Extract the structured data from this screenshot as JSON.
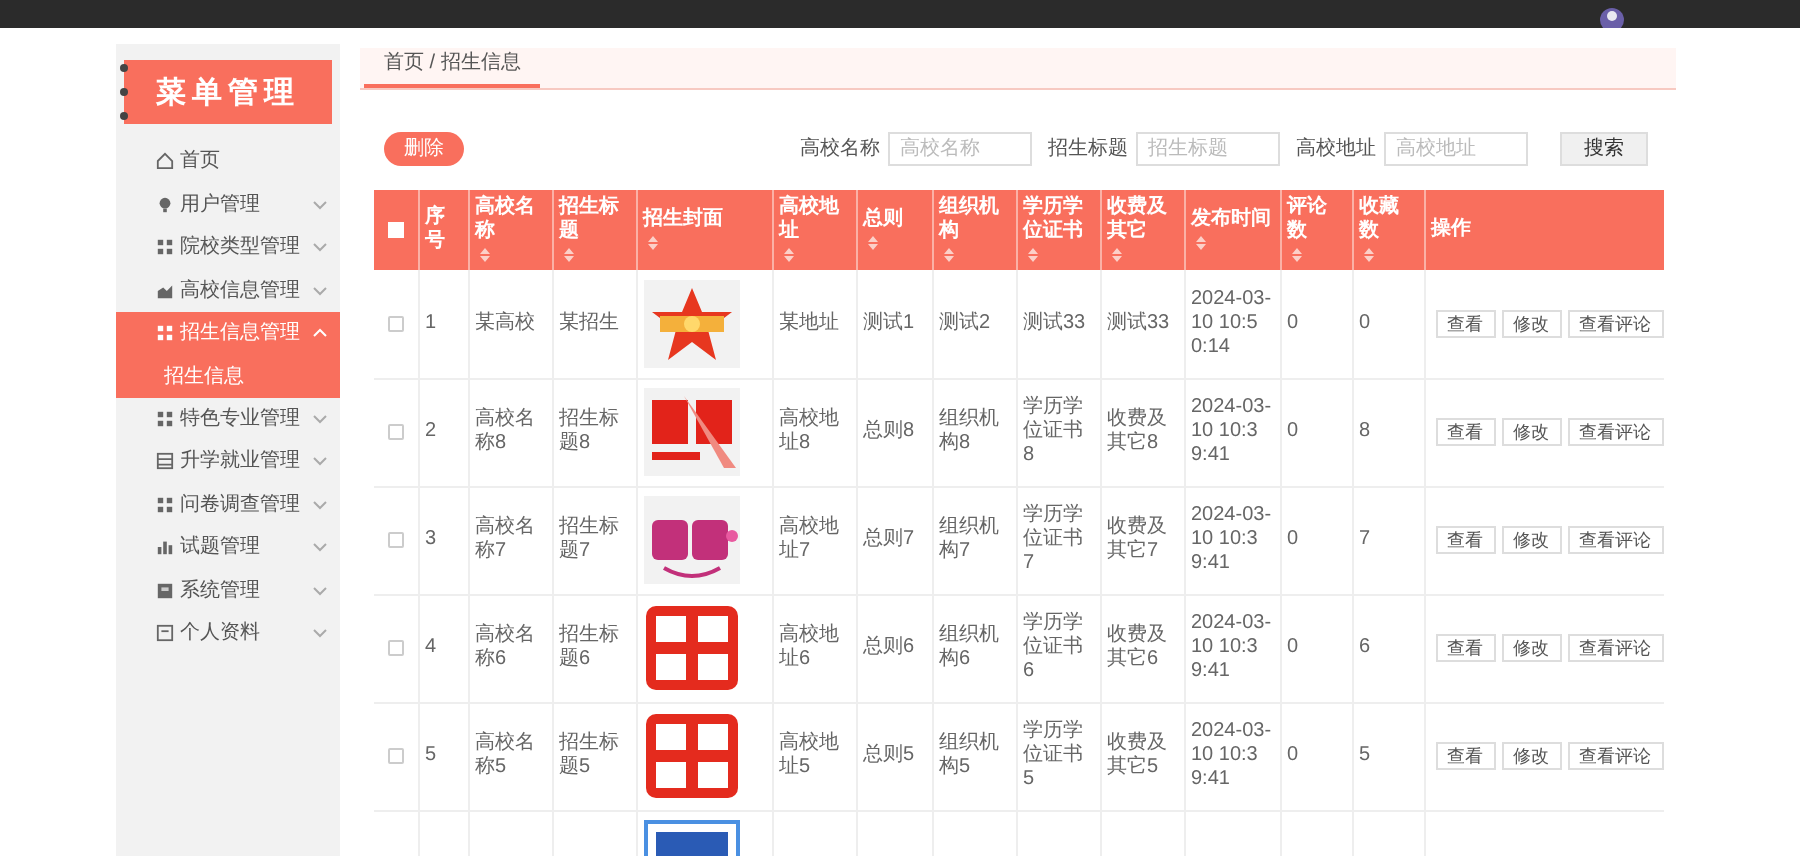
{
  "sidebar": {
    "title": "菜单管理",
    "items": [
      {
        "label": "首页"
      },
      {
        "label": "用户管理",
        "expanded": false,
        "selected": false
      },
      {
        "label": "院校类型管理",
        "expanded": false,
        "selected": false
      },
      {
        "label": "高校信息管理",
        "expanded": false,
        "selected": false
      },
      {
        "label": "招生信息管理",
        "expanded": true,
        "selected": true,
        "children": [
          {
            "label": "招生信息",
            "selected": true
          }
        ]
      },
      {
        "label": "特色专业管理",
        "expanded": false,
        "selected": false
      },
      {
        "label": "升学就业管理",
        "expanded": false,
        "selected": false
      },
      {
        "label": "问卷调查管理",
        "expanded": false,
        "selected": false
      },
      {
        "label": "试题管理",
        "expanded": false,
        "selected": false
      },
      {
        "label": "系统管理",
        "expanded": false,
        "selected": false
      },
      {
        "label": "个人资料",
        "expanded": false,
        "selected": false
      }
    ]
  },
  "breadcrumb": "首页 / 招生信息",
  "toolbar": {
    "delete_button": "删除",
    "filters": [
      {
        "label": "高校名称",
        "placeholder": "高校名称"
      },
      {
        "label": "招生标题",
        "placeholder": "招生标题"
      },
      {
        "label": "高校地址",
        "placeholder": "高校地址"
      }
    ],
    "search_button": "搜索"
  },
  "table": {
    "select_all": {
      "checked": false
    },
    "columns": [
      {
        "label": "序号",
        "sortable": false
      },
      {
        "label": "高校名称",
        "sortable": true
      },
      {
        "label": "招生标题",
        "sortable": true
      },
      {
        "label": "招生封面",
        "sortable": true
      },
      {
        "label": "高校地址",
        "sortable": true
      },
      {
        "label": "总则",
        "sortable": true
      },
      {
        "label": "组织机构",
        "sortable": true
      },
      {
        "label": "学历学位证书",
        "sortable": true
      },
      {
        "label": "收费及其它",
        "sortable": true
      },
      {
        "label": "发布时间",
        "sortable": true
      },
      {
        "label": "评论数",
        "sortable": true
      },
      {
        "label": "收藏数",
        "sortable": true
      },
      {
        "label": "操作",
        "sortable": false
      }
    ],
    "rows": [
      {
        "selected": false,
        "actions": [
          "查看",
          "修改",
          "查看评论"
        ],
        "cells": [
          "1",
          "某高校",
          "某招生",
          "",
          "某地址",
          "测试1",
          "测试2",
          "测试33",
          "测试33",
          "2024-03-10 10:50:14",
          "0",
          "0"
        ]
      },
      {
        "selected": false,
        "actions": [
          "查看",
          "修改",
          "查看评论"
        ],
        "cells": [
          "2",
          "高校名称8",
          "招生标题8",
          "",
          "高校地址8",
          "总则8",
          "组织机构8",
          "学历学位证书8",
          "收费及其它8",
          "2024-03-10 10:39:41",
          "0",
          "8"
        ]
      },
      {
        "selected": false,
        "actions": [
          "查看",
          "修改",
          "查看评论"
        ],
        "cells": [
          "3",
          "高校名称7",
          "招生标题7",
          "",
          "高校地址7",
          "总则7",
          "组织机构7",
          "学历学位证书7",
          "收费及其它7",
          "2024-03-10 10:39:41",
          "0",
          "7"
        ]
      },
      {
        "selected": false,
        "actions": [
          "查看",
          "修改",
          "查看评论"
        ],
        "cells": [
          "4",
          "高校名称6",
          "招生标题6",
          "",
          "高校地址6",
          "总则6",
          "组织机构6",
          "学历学位证书6",
          "收费及其它6",
          "2024-03-10 10:39:41",
          "0",
          "6"
        ]
      },
      {
        "selected": false,
        "actions": [
          "查看",
          "修改",
          "查看评论"
        ],
        "cells": [
          "5",
          "高校名称5",
          "招生标题5",
          "",
          "高校地址5",
          "总则5",
          "组织机构5",
          "学历学位证书5",
          "收费及其它5",
          "2024-03-10 10:39:41",
          "0",
          "5"
        ]
      }
    ]
  }
}
